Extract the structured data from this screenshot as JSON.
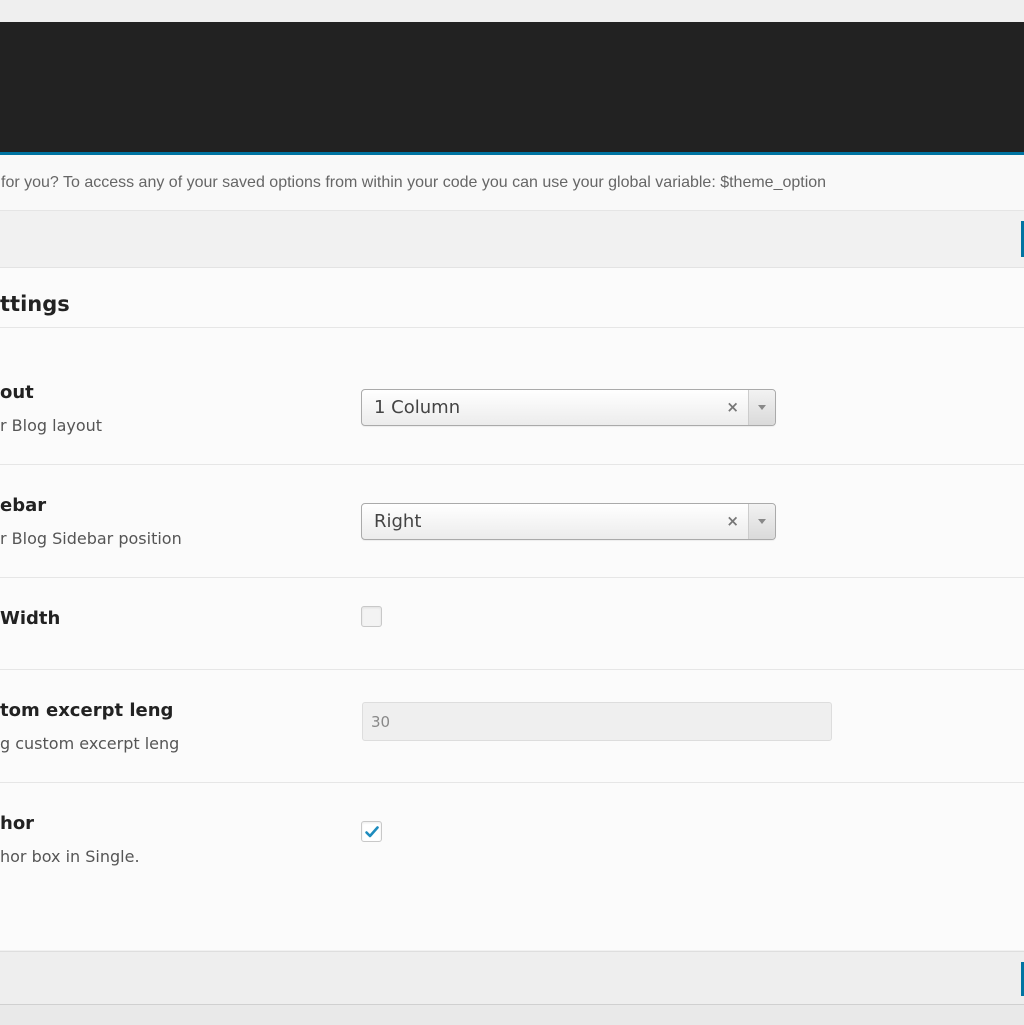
{
  "notice": {
    "text": "for you? To access any of your saved options from within your code you can use your global variable: $theme_option"
  },
  "section": {
    "title": "ttings"
  },
  "options": [
    {
      "title": "out",
      "description": "r Blog layout",
      "control": "select",
      "value": "1 Column"
    },
    {
      "title": "ebar",
      "description": "r Blog Sidebar position",
      "control": "select",
      "value": "Right"
    },
    {
      "title": " Width",
      "description": "",
      "control": "checkbox",
      "checked": false
    },
    {
      "title": "tom excerpt leng",
      "description": "g custom excerpt leng",
      "control": "text",
      "value": "30"
    },
    {
      "title": "hor",
      "description": "hor box in Single.",
      "control": "checkbox",
      "checked": true
    }
  ],
  "select_clear_symbol": "×",
  "colors": {
    "header_bg": "#222222",
    "accent": "#0074a2",
    "check": "#1e8cbe"
  }
}
